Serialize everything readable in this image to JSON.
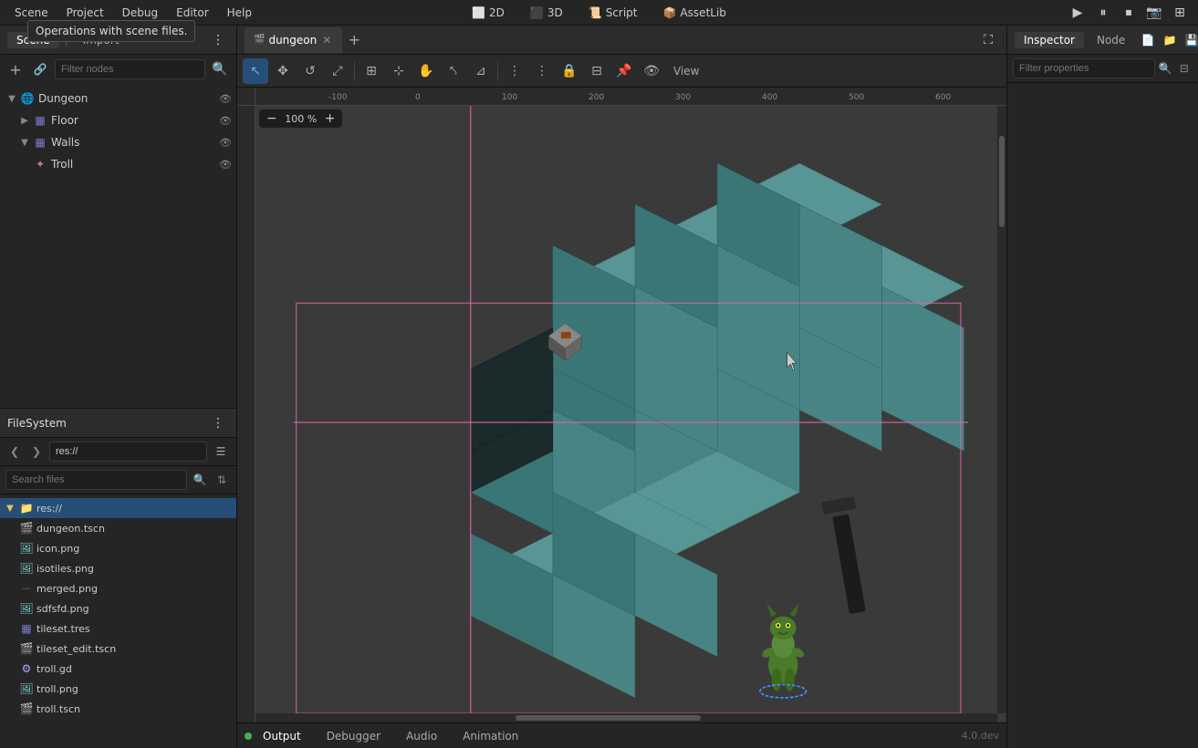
{
  "menu": {
    "items": [
      "Scene",
      "Project",
      "Debug",
      "Editor",
      "Help"
    ],
    "tooltip": "Operations with scene files.",
    "tools": [
      {
        "label": "2D",
        "icon": "⬜",
        "active": false
      },
      {
        "label": "3D",
        "icon": "⬛",
        "active": false
      },
      {
        "label": "Script",
        "icon": "📜",
        "active": false
      },
      {
        "label": "AssetLib",
        "icon": "📦",
        "active": false
      }
    ],
    "right_icons": [
      "▶",
      "⏸",
      "⏹",
      "📷",
      "⊞"
    ]
  },
  "scene_panel": {
    "title": "Scene",
    "import_label": "Import",
    "filter_placeholder": "Filter nodes",
    "nodes": [
      {
        "id": "dungeon",
        "label": "Dungeon",
        "icon": "🌐",
        "indent": 0,
        "expanded": true,
        "color": "#4a8f4a"
      },
      {
        "id": "floor",
        "label": "Floor",
        "icon": "▦",
        "indent": 1,
        "expanded": false,
        "color": "#7a7acd"
      },
      {
        "id": "walls",
        "label": "Walls",
        "icon": "▦",
        "indent": 1,
        "expanded": true,
        "color": "#7a7acd"
      },
      {
        "id": "troll",
        "label": "Troll",
        "icon": "✦",
        "indent": 2,
        "expanded": false,
        "color": "#cd7a7a"
      }
    ]
  },
  "filesystem_panel": {
    "title": "FileSystem",
    "path": "res://",
    "search_placeholder": "Search files",
    "files": [
      {
        "id": "res",
        "label": "res://",
        "icon": "📁",
        "indent": 0,
        "type": "folder",
        "selected": true
      },
      {
        "id": "dungeon_tscn",
        "label": "dungeon.tscn",
        "icon": "🎬",
        "indent": 1,
        "type": "scene"
      },
      {
        "id": "icon_png",
        "label": "icon.png",
        "icon": "🖼",
        "indent": 1,
        "type": "png"
      },
      {
        "id": "isotiles_png",
        "label": "isotiles.png",
        "icon": "🖼",
        "indent": 1,
        "type": "png"
      },
      {
        "id": "merged_png",
        "label": "merged.png",
        "icon": "—",
        "indent": 1,
        "type": "png"
      },
      {
        "id": "sdfsfd_png",
        "label": "sdfsfd.png",
        "icon": "🖼",
        "indent": 1,
        "type": "png"
      },
      {
        "id": "tileset_tres",
        "label": "tileset.tres",
        "icon": "▦",
        "indent": 1,
        "type": "tres"
      },
      {
        "id": "tileset_edit",
        "label": "tileset_edit.tscn",
        "icon": "🎬",
        "indent": 1,
        "type": "scene"
      },
      {
        "id": "troll_gd",
        "label": "troll.gd",
        "icon": "⚙",
        "indent": 1,
        "type": "gd"
      },
      {
        "id": "troll_png",
        "label": "troll.png",
        "icon": "🖼",
        "indent": 1,
        "type": "png"
      },
      {
        "id": "troll_tscn",
        "label": "troll.tscn",
        "icon": "🎬",
        "indent": 1,
        "type": "scene"
      }
    ]
  },
  "viewport": {
    "tabs": [
      {
        "id": "dungeon",
        "label": "dungeon",
        "active": true,
        "closeable": true
      }
    ],
    "zoom": "100 %",
    "tools": [
      {
        "id": "select",
        "icon": "↖",
        "active": true
      },
      {
        "id": "move",
        "icon": "✥",
        "active": false
      },
      {
        "id": "rotate",
        "icon": "↺",
        "active": false
      },
      {
        "id": "scale",
        "icon": "⤢",
        "active": false
      },
      {
        "id": "snap",
        "icon": "⊞",
        "active": false
      },
      {
        "id": "lock",
        "icon": "🔒",
        "active": false
      },
      {
        "id": "transform",
        "icon": "⊹",
        "active": false
      },
      {
        "id": "pivot",
        "icon": "◎",
        "active": false
      },
      {
        "id": "more",
        "icon": "⋮",
        "active": false
      },
      {
        "id": "anchor",
        "icon": "⚓",
        "active": false
      },
      {
        "id": "view_label",
        "label": "View",
        "type": "label"
      }
    ]
  },
  "inspector": {
    "title": "Inspector",
    "node_label": "Node",
    "filter_placeholder": "Filter properties",
    "tabs": [
      "Inspector",
      "Node"
    ]
  },
  "bottom_bar": {
    "tabs": [
      "Output",
      "Debugger",
      "Audio",
      "Animation"
    ],
    "active_tab": "Output",
    "status_color": "#4caf50",
    "version": "4.0.dev"
  }
}
